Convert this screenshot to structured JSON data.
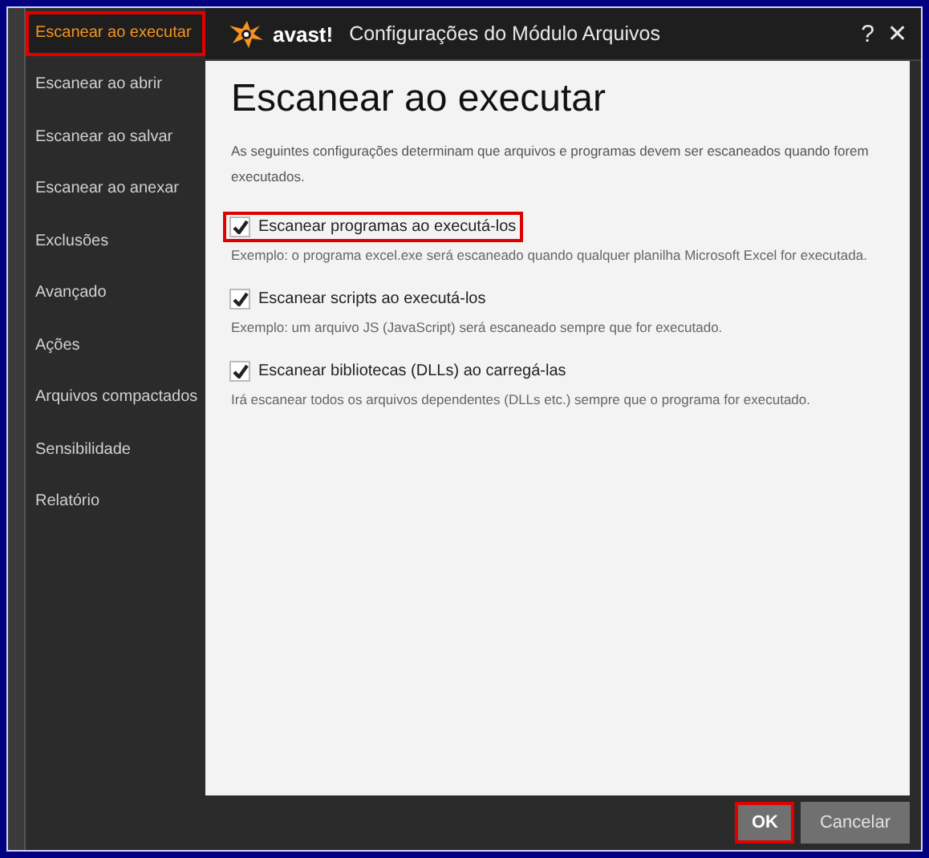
{
  "window": {
    "title": "Configurações do Módulo Arquivos",
    "brand": "avast!",
    "help": "?",
    "close": "✕"
  },
  "sidebar": {
    "items": [
      {
        "label": "Escanear ao executar",
        "selected": true,
        "highlighted": true
      },
      {
        "label": "Escanear ao abrir",
        "selected": false,
        "highlighted": false
      },
      {
        "label": "Escanear ao salvar",
        "selected": false,
        "highlighted": false
      },
      {
        "label": "Escanear ao anexar",
        "selected": false,
        "highlighted": false
      },
      {
        "label": "Exclusões",
        "selected": false,
        "highlighted": false
      },
      {
        "label": "Avançado",
        "selected": false,
        "highlighted": false
      },
      {
        "label": "Ações",
        "selected": false,
        "highlighted": false
      },
      {
        "label": "Arquivos compactados",
        "selected": false,
        "highlighted": false
      },
      {
        "label": "Sensibilidade",
        "selected": false,
        "highlighted": false
      },
      {
        "label": "Relatório",
        "selected": false,
        "highlighted": false
      }
    ]
  },
  "content": {
    "heading": "Escanear ao executar",
    "intro": "As seguintes configurações determinam que arquivos e programas devem ser escaneados quando forem executados.",
    "options": [
      {
        "label": "Escanear programas ao executá-los",
        "checked": true,
        "highlighted": true,
        "description": "Exemplo: o programa excel.exe será escaneado quando qualquer planilha Microsoft Excel for executada."
      },
      {
        "label": "Escanear scripts ao executá-los",
        "checked": true,
        "highlighted": false,
        "description": "Exemplo: um arquivo JS (JavaScript) será escaneado sempre que for executado."
      },
      {
        "label": "Escanear bibliotecas (DLLs) ao carregá-las",
        "checked": true,
        "highlighted": false,
        "description": "Irá escanear todos os arquivos dependentes (DLLs etc.) sempre que o programa for executado."
      }
    ]
  },
  "buttons": [
    {
      "label": "OK",
      "kind": "primary",
      "highlighted": true
    },
    {
      "label": "Cancelar",
      "kind": "secondary",
      "highlighted": false
    }
  ]
}
